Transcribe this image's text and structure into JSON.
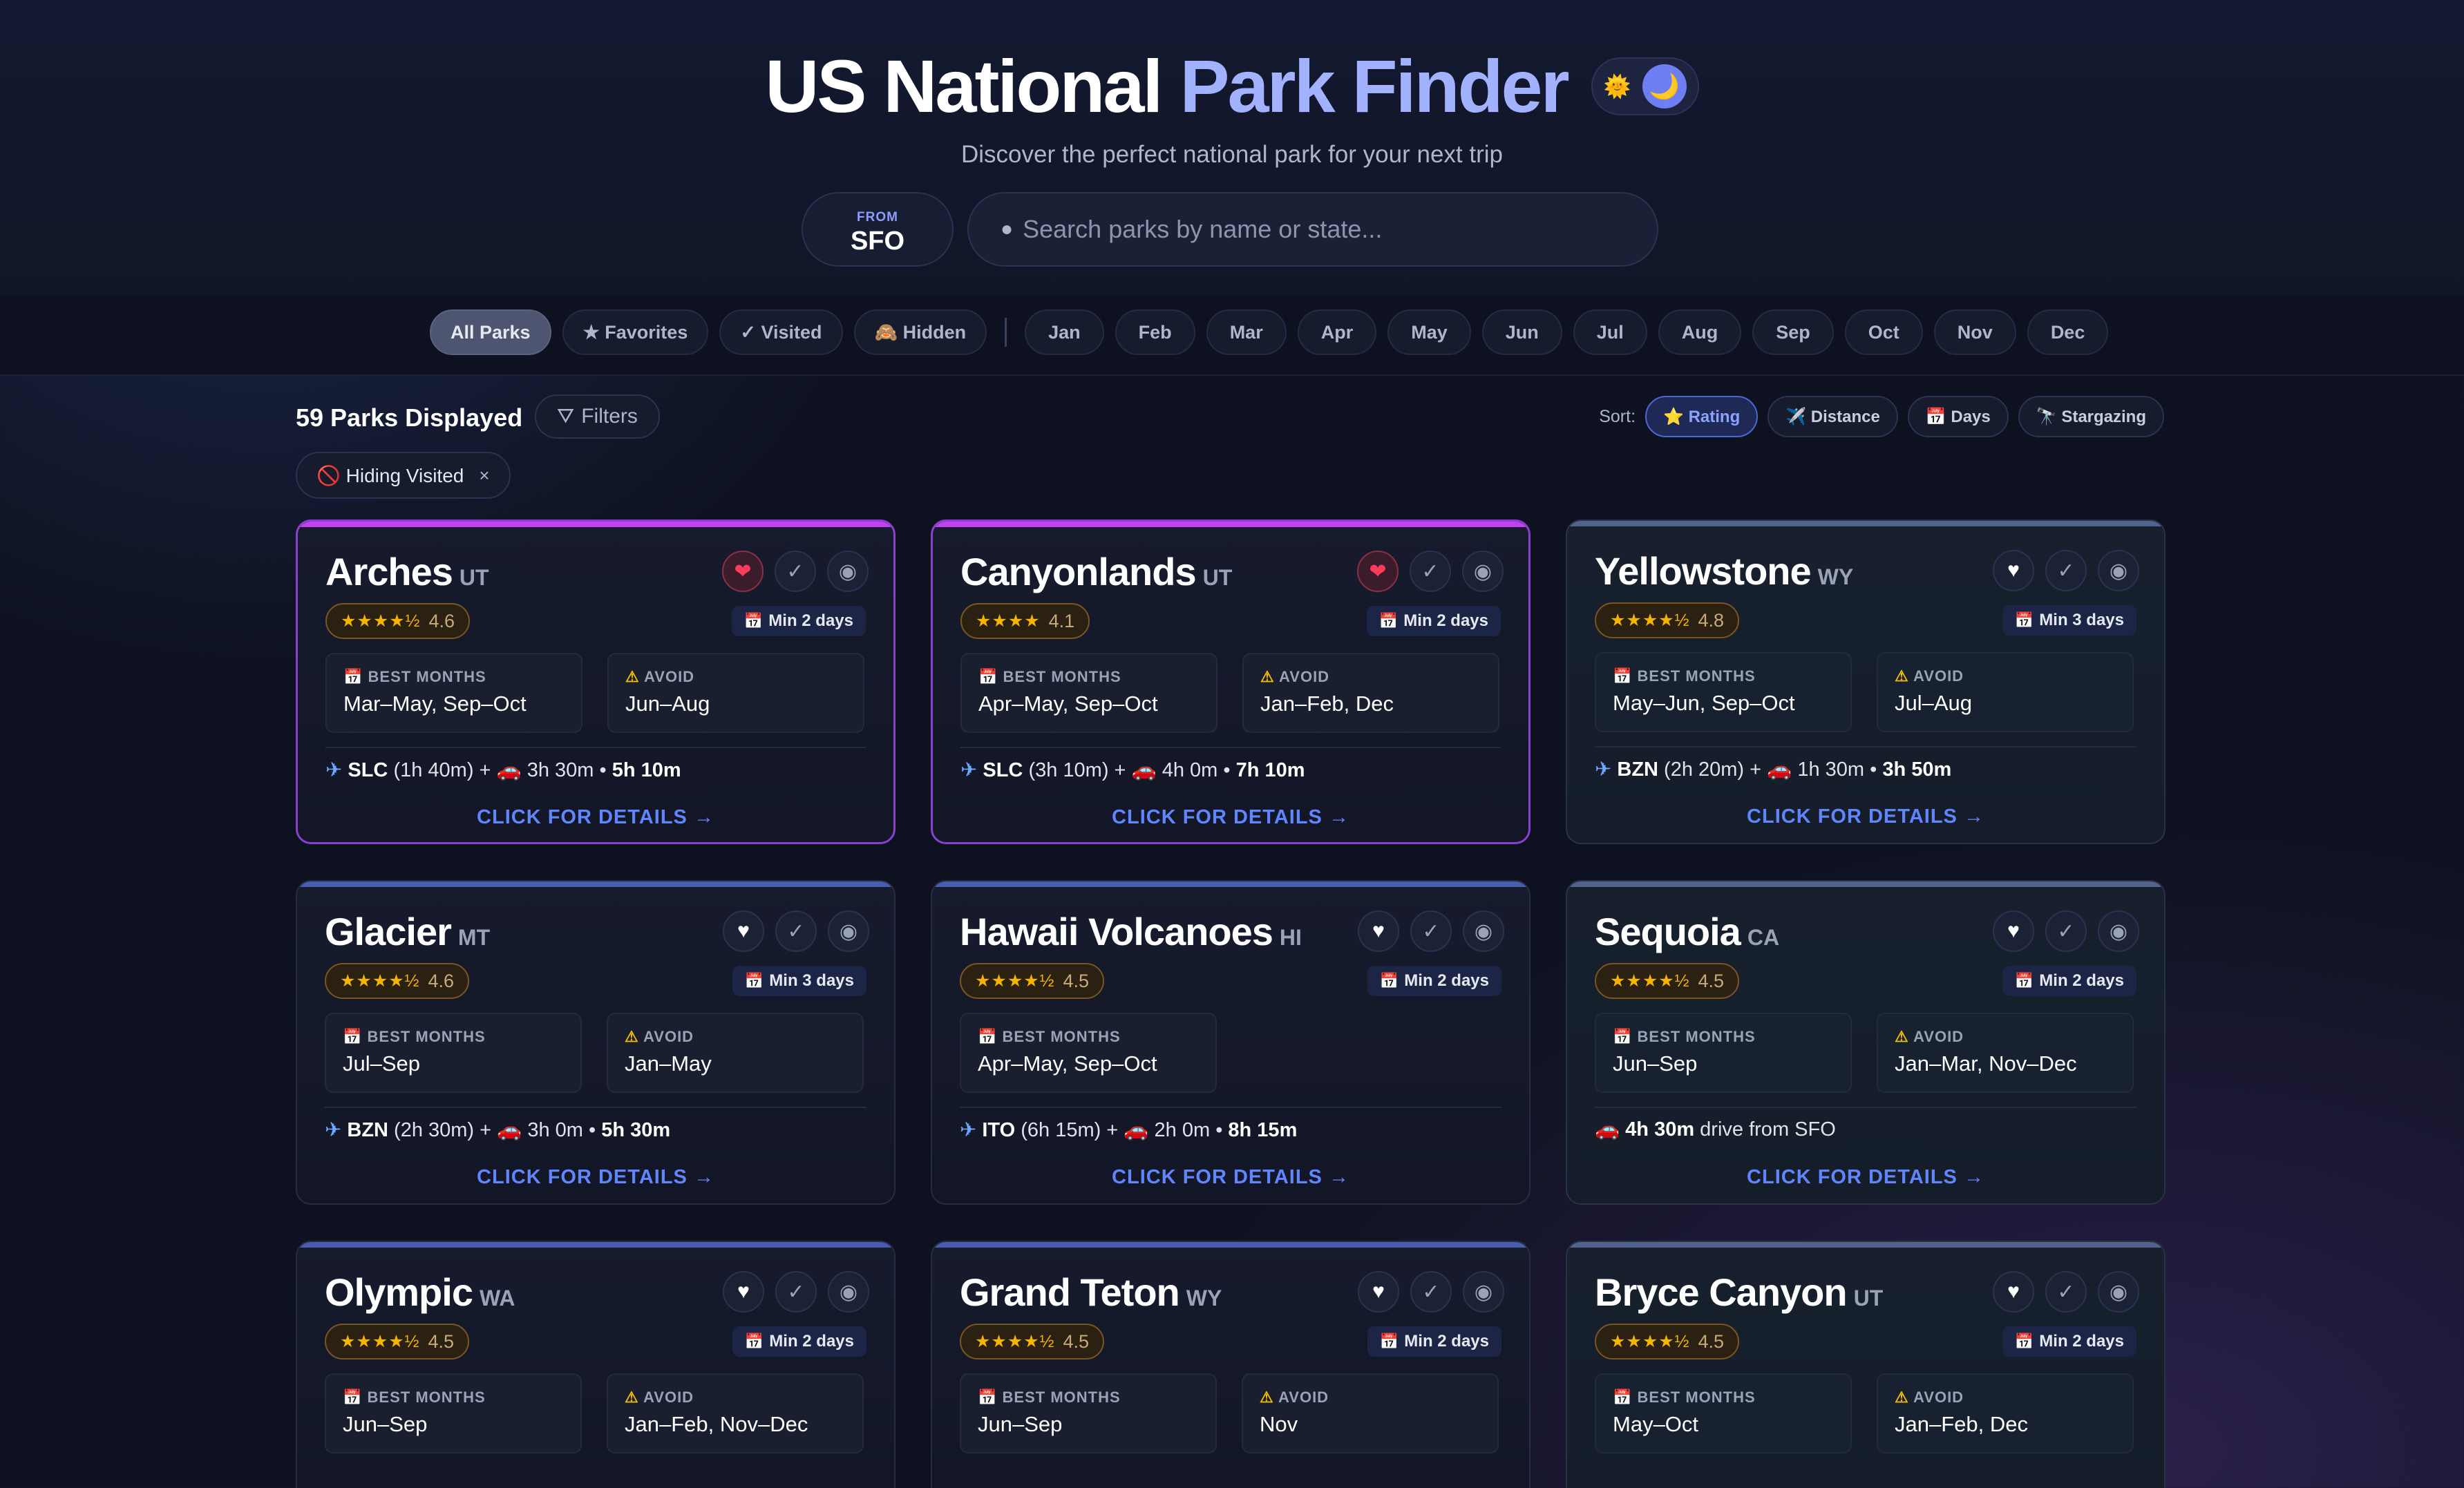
{
  "header": {
    "title_part1": "US National ",
    "title_part2": "Park Finder",
    "theme_sun": "🌞",
    "theme_moon": "🌙",
    "subtitle": "Discover the perfect national park for your next trip",
    "from_label": "FROM",
    "from_code": "SFO",
    "search_placeholder": "Search parks by name or state..."
  },
  "filters": {
    "all": "All Parks",
    "favorites": "★ Favorites",
    "visited": "✓ Visited",
    "hidden": "🙈 Hidden",
    "months": [
      "Jan",
      "Feb",
      "Mar",
      "Apr",
      "May",
      "Jun",
      "Jul",
      "Aug",
      "Sep",
      "Oct",
      "Nov",
      "Dec"
    ]
  },
  "toolbar": {
    "count": "59 Parks Displayed",
    "filters_label": "Filters",
    "sort_label": "Sort:",
    "sort_rating": "⭐ Rating",
    "sort_distance": "✈️ Distance",
    "sort_days": "📅 Days",
    "sort_stargazing": "🔭 Stargazing",
    "hiding_tag": "🚫 Hiding Visited",
    "hiding_close": "×"
  },
  "labels": {
    "best_months": "BEST MONTHS",
    "avoid": "AVOID",
    "details": "CLICK FOR DETAILS →",
    "plane_icon": "✈",
    "car_icon": "🚗",
    "cal_icon": "📅",
    "warn_icon": "⚠"
  },
  "parks": [
    {
      "name": "Arches",
      "state": "UT",
      "stars": "★★★★½",
      "rating": "4.6",
      "min_days": "Min 2 days",
      "best": "Mar–May, Sep–Oct",
      "avoid": "Jun–Aug",
      "airport": "SLC",
      "flight": "(1h 40m) +",
      "drive": "3h 30m •",
      "total": "5h 10m",
      "fav": true
    },
    {
      "name": "Canyonlands",
      "state": "UT",
      "stars": "★★★★",
      "rating": "4.1",
      "min_days": "Min 2 days",
      "best": "Apr–May, Sep–Oct",
      "avoid": "Jan–Feb, Dec",
      "airport": "SLC",
      "flight": "(3h 10m) +",
      "drive": "4h 0m •",
      "total": "7h 10m",
      "fav": true
    },
    {
      "name": "Yellowstone",
      "state": "WY",
      "stars": "★★★★½",
      "rating": "4.8",
      "min_days": "Min 3 days",
      "best": "May–Jun, Sep–Oct",
      "avoid": "Jul–Aug",
      "airport": "BZN",
      "flight": "(2h 20m) +",
      "drive": "1h 30m •",
      "total": "3h 50m",
      "fav": false
    },
    {
      "name": "Glacier",
      "state": "MT",
      "stars": "★★★★½",
      "rating": "4.6",
      "min_days": "Min 3 days",
      "best": "Jul–Sep",
      "avoid": "Jan–May",
      "airport": "BZN",
      "flight": "(2h 30m) +",
      "drive": "3h 0m •",
      "total": "5h 30m",
      "fav": false
    },
    {
      "name": "Hawaii Volcanoes",
      "state": "HI",
      "stars": "★★★★½",
      "rating": "4.5",
      "min_days": "Min 2 days",
      "best": "Apr–May, Sep–Oct",
      "avoid": "",
      "airport": "ITO",
      "flight": "(6h 15m) +",
      "drive": "2h 0m •",
      "total": "8h 15m",
      "fav": false
    },
    {
      "name": "Sequoia",
      "state": "CA",
      "stars": "★★★★½",
      "rating": "4.5",
      "min_days": "Min 2 days",
      "best": "Jun–Sep",
      "avoid": "Jan–Mar, Nov–Dec",
      "drive_only": "4h 30m",
      "drive_text": " drive from SFO",
      "fav": false
    },
    {
      "name": "Olympic",
      "state": "WA",
      "stars": "★★★★½",
      "rating": "4.5",
      "min_days": "Min 2 days",
      "best": "Jun–Sep",
      "avoid": "Jan–Feb, Nov–Dec",
      "fav": false
    },
    {
      "name": "Grand Teton",
      "state": "WY",
      "stars": "★★★★½",
      "rating": "4.5",
      "min_days": "Min 2 days",
      "best": "Jun–Sep",
      "avoid": "Nov",
      "fav": false
    },
    {
      "name": "Bryce Canyon",
      "state": "UT",
      "stars": "★★★★½",
      "rating": "4.5",
      "min_days": "Min 2 days",
      "best": "May–Oct",
      "avoid": "Jan–Feb, Dec",
      "fav": false
    }
  ]
}
